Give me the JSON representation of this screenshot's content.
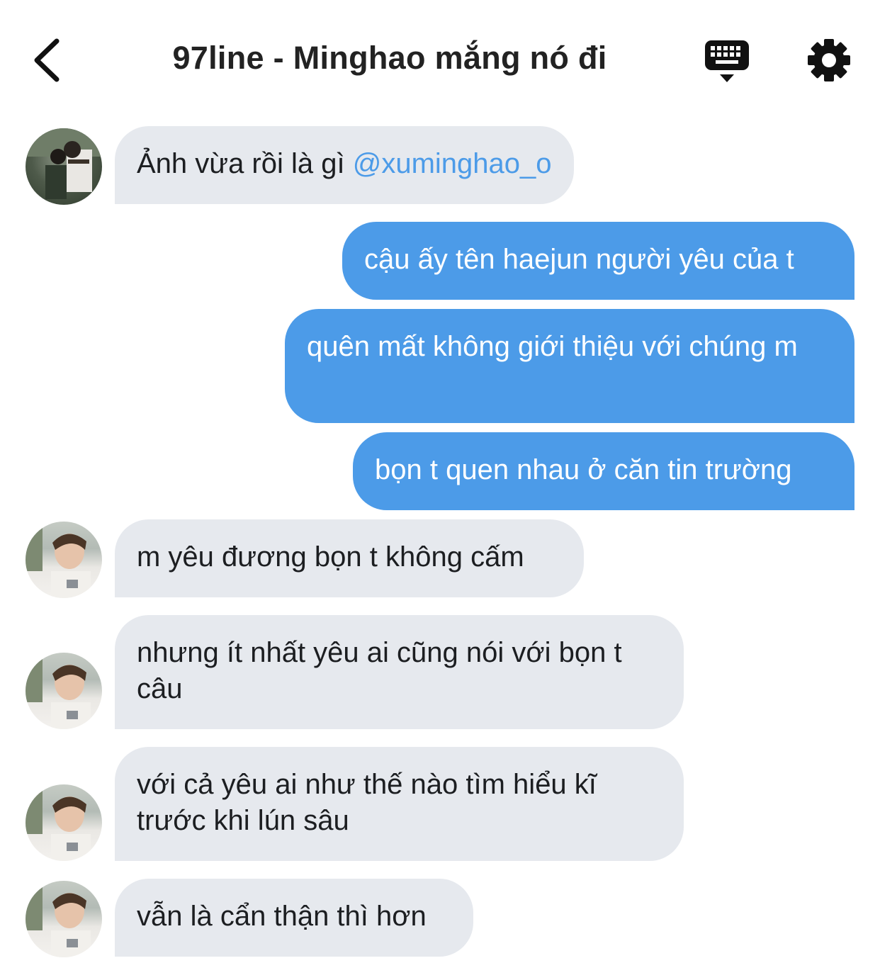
{
  "header": {
    "title": "97line - Minghao mắng nó đi",
    "back_icon": "chevron-left-icon",
    "keyboard_icon": "keyboard-icon",
    "settings_icon": "gear-icon"
  },
  "colors": {
    "sent_bubble": "#4c9be8",
    "received_bubble": "#e6e9ee",
    "mention": "#4c9be8"
  },
  "messages": [
    {
      "side": "received",
      "sender": "group-member",
      "text": "Ảnh vừa rồi là gì ",
      "mention": "@xuminghao_o"
    },
    {
      "side": "sent",
      "text": "cậu ấy tên haejun người yêu của t"
    },
    {
      "side": "sent",
      "text": "quên mất không giới thiệu với chúng m"
    },
    {
      "side": "sent",
      "text": "bọn t quen nhau ở căn tin trường"
    },
    {
      "side": "received",
      "sender": "minghao",
      "text": "m yêu đương bọn t không cấm"
    },
    {
      "side": "received",
      "sender": "minghao",
      "text": "nhưng ít nhất yêu ai cũng nói với bọn t câu"
    },
    {
      "side": "received",
      "sender": "minghao",
      "text": "với cả yêu ai như thế nào tìm hiểu kĩ trước khi lún sâu"
    },
    {
      "side": "received",
      "sender": "minghao",
      "text": "vẫn là cẩn thận thì hơn"
    }
  ]
}
